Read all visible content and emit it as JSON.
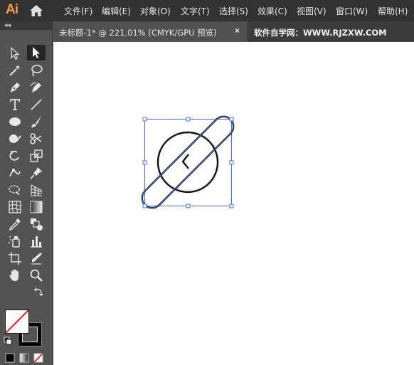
{
  "app": {
    "logo": "Ai",
    "home_icon": "home-icon"
  },
  "menu": [
    {
      "label": "文件(F)"
    },
    {
      "label": "编辑(E)"
    },
    {
      "label": "对象(O)"
    },
    {
      "label": "文字(T)"
    },
    {
      "label": "选择(S)"
    },
    {
      "label": "效果(C)"
    },
    {
      "label": "视图(V)"
    },
    {
      "label": "窗口(W)"
    },
    {
      "label": "帮助(H)"
    }
  ],
  "tabs": {
    "document_title": "未标题-1* @ 221.01% (CMYK/GPU 预览)",
    "close_glyph": "×",
    "site_label": "软件自学网：WWW.RJZXW.COM"
  },
  "toolbar": {
    "collapse_glyph": "◂◂",
    "tools": [
      "selection-tool",
      "direct-selection-tool",
      "magic-wand-tool",
      "lasso-tool",
      "pen-tool",
      "curvature-tool",
      "type-tool",
      "line-segment-tool",
      "ellipse-tool",
      "paintbrush-tool",
      "shaper-tool",
      "scissors-tool",
      "rotate-tool",
      "scale-tool",
      "puppet-warp-tool",
      "pin-tool",
      "free-transform-tool",
      "perspective-grid-tool",
      "mesh-tool",
      "gradient-tool",
      "eyedropper-tool",
      "blend-tool",
      "symbol-sprayer-tool",
      "column-graph-tool",
      "artboard-tool",
      "slice-tool",
      "hand-tool",
      "zoom-tool"
    ],
    "selected_tool": "direct-selection-tool",
    "fill_color": "#ffffff",
    "stroke_color": "#000000"
  },
  "colors": {
    "menubar_bg": "#323232",
    "panel_bg": "#535353",
    "canvas_bg": "#ffffff",
    "selection_blue": "#4a6fd8",
    "logo_orange": "#f79a46"
  }
}
